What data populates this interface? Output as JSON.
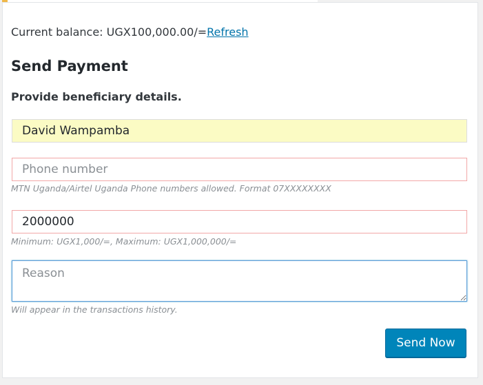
{
  "balance": {
    "text": "Current balance: UGX100,000.00/=",
    "refresh_label": "Refresh"
  },
  "form": {
    "title": "Send Payment",
    "subtitle": "Provide beneficiary details.",
    "name": {
      "value": "David Wampamba"
    },
    "phone": {
      "value": "",
      "placeholder": "Phone number",
      "hint": "MTN Uganda/Airtel Uganda Phone numbers allowed. Format 07XXXXXXXX"
    },
    "amount": {
      "value": "2000000",
      "hint": "Minimum: UGX1,000/=, Maximum: UGX1,000,000/="
    },
    "reason": {
      "value": "",
      "placeholder": "Reason",
      "hint": "Will appear in the transactions history."
    },
    "submit_label": "Send Now"
  },
  "colors": {
    "link": "#0073aa",
    "button": "#0085ba",
    "autofill_bg": "#fbfbc4",
    "error_border": "#f2a7a7",
    "focus_border": "#5b9dd9"
  }
}
